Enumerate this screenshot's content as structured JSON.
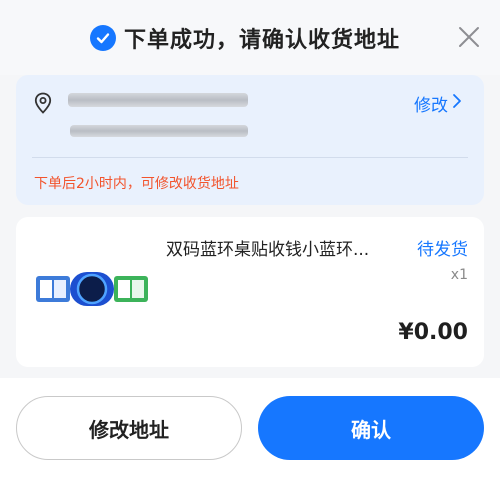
{
  "header": {
    "title": "下单成功，请确认收货地址"
  },
  "address": {
    "edit_label": "修改",
    "hint": "下单后2小时内，可修改收货地址"
  },
  "goods": {
    "name": "双码蓝环桌贴收钱小蓝环...",
    "status": "待发货",
    "quantity": "x1",
    "price": "¥0.00"
  },
  "footer": {
    "edit_address_label": "修改地址",
    "confirm_label": "确认"
  },
  "colors": {
    "accent": "#1677ff",
    "warning": "#f2542d"
  }
}
